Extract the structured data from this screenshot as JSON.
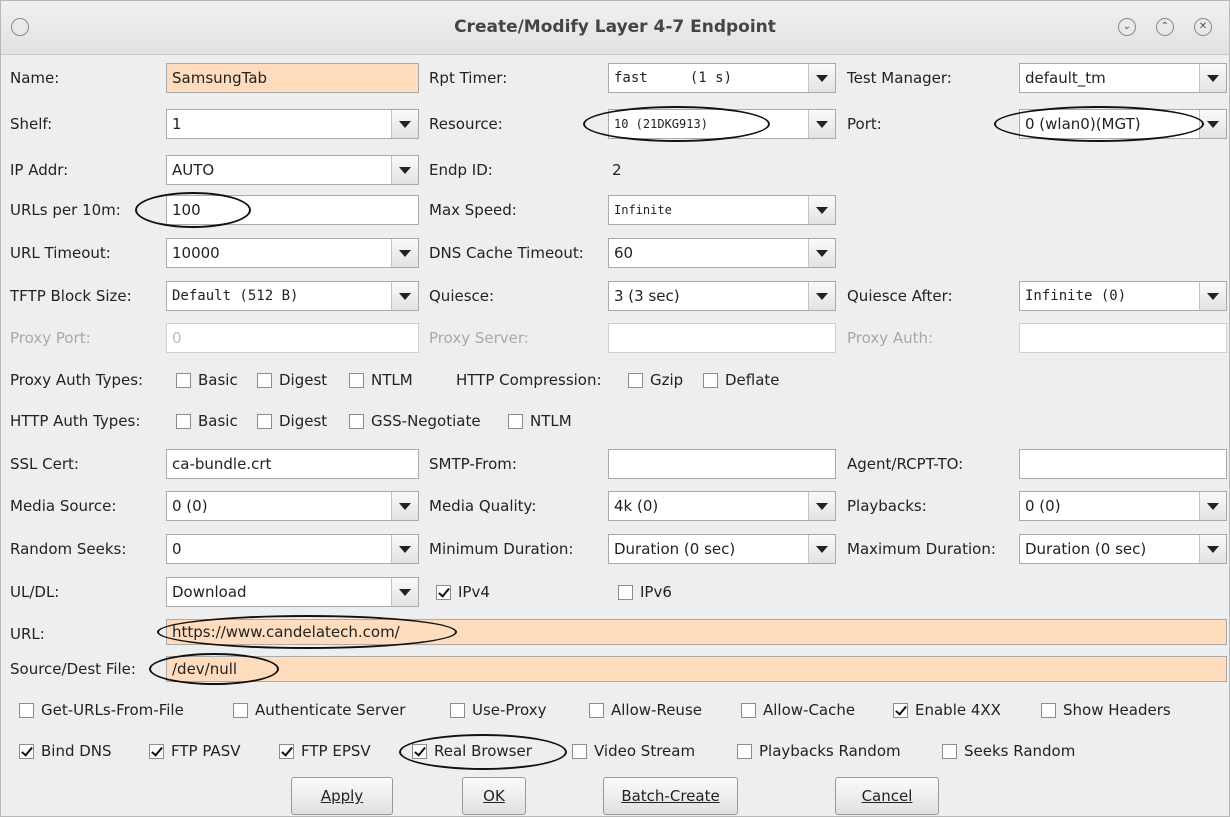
{
  "window": {
    "title": "Create/Modify Layer 4-7 Endpoint"
  },
  "labels": {
    "name": "Name:",
    "rpt_timer": "Rpt Timer:",
    "test_manager": "Test Manager:",
    "shelf": "Shelf:",
    "resource": "Resource:",
    "port": "Port:",
    "ip_addr": "IP Addr:",
    "endp_id": "Endp ID:",
    "urls_per_10m": "URLs per 10m:",
    "max_speed": "Max Speed:",
    "url_timeout": "URL Timeout:",
    "dns_cache_timeout": "DNS Cache Timeout:",
    "tftp_block_size": "TFTP Block Size:",
    "quiesce": "Quiesce:",
    "quiesce_after": "Quiesce After:",
    "proxy_port": "Proxy Port:",
    "proxy_server": "Proxy Server:",
    "proxy_auth": "Proxy Auth:",
    "proxy_auth_types": "Proxy Auth Types:",
    "http_compression": "HTTP Compression:",
    "http_auth_types": "HTTP Auth Types:",
    "ssl_cert": "SSL Cert:",
    "smtp_from": "SMTP-From:",
    "agent_rcpt_to": "Agent/RCPT-TO:",
    "media_source": "Media Source:",
    "media_quality": "Media Quality:",
    "playbacks": "Playbacks:",
    "random_seeks": "Random Seeks:",
    "minimum_duration": "Minimum Duration:",
    "maximum_duration": "Maximum Duration:",
    "ul_dl": "UL/DL:",
    "url": "URL:",
    "source_dest_file": "Source/Dest File:"
  },
  "values": {
    "name": "SamsungTab",
    "rpt_timer": "fast     (1 s)",
    "test_manager": "default_tm",
    "shelf": "1",
    "resource": "10 (21DKG913)",
    "port": "0 (wlan0)(MGT)",
    "ip_addr": "AUTO",
    "endp_id": "2",
    "urls_per_10m": "100",
    "max_speed": "Infinite",
    "url_timeout": "10000",
    "dns_cache_timeout": "60",
    "tftp_block_size": "Default (512 B)",
    "quiesce": "3 (3 sec)",
    "quiesce_after": "Infinite (0)",
    "proxy_port": "0",
    "proxy_server": "",
    "proxy_auth": "",
    "ssl_cert": "ca-bundle.crt",
    "smtp_from": "",
    "agent_rcpt_to": "",
    "media_source": "0 (0)",
    "media_quality": "4k (0)",
    "playbacks": "0 (0)",
    "random_seeks": "0",
    "minimum_duration": "Duration (0 sec)",
    "maximum_duration": "Duration (0 sec)",
    "ul_dl": "Download",
    "url": "https://www.candelatech.com/",
    "source_dest_file": "/dev/null"
  },
  "checkboxes": {
    "proxy_basic": {
      "label": "Basic",
      "checked": false
    },
    "proxy_digest": {
      "label": "Digest",
      "checked": false
    },
    "proxy_ntlm": {
      "label": "NTLM",
      "checked": false
    },
    "gzip": {
      "label": "Gzip",
      "checked": false
    },
    "deflate": {
      "label": "Deflate",
      "checked": false
    },
    "http_basic": {
      "label": "Basic",
      "checked": false
    },
    "http_digest": {
      "label": "Digest",
      "checked": false
    },
    "gss_negotiate": {
      "label": "GSS-Negotiate",
      "checked": false
    },
    "http_ntlm": {
      "label": "NTLM",
      "checked": false
    },
    "ipv4": {
      "label": "IPv4",
      "checked": true
    },
    "ipv6": {
      "label": "IPv6",
      "checked": false
    },
    "get_urls_from_file": {
      "label": "Get-URLs-From-File",
      "checked": false
    },
    "authenticate_server": {
      "label": "Authenticate Server",
      "checked": false
    },
    "use_proxy": {
      "label": "Use-Proxy",
      "checked": false
    },
    "allow_reuse": {
      "label": "Allow-Reuse",
      "checked": false
    },
    "allow_cache": {
      "label": "Allow-Cache",
      "checked": false
    },
    "enable_4xx": {
      "label": "Enable 4XX",
      "checked": true
    },
    "show_headers": {
      "label": "Show Headers",
      "checked": false
    },
    "bind_dns": {
      "label": "Bind DNS",
      "checked": true
    },
    "ftp_pasv": {
      "label": "FTP PASV",
      "checked": true
    },
    "ftp_epsv": {
      "label": "FTP EPSV",
      "checked": true
    },
    "real_browser": {
      "label": "Real Browser",
      "checked": true
    },
    "video_stream": {
      "label": "Video Stream",
      "checked": false
    },
    "playbacks_random": {
      "label": "Playbacks Random",
      "checked": false
    },
    "seeks_random": {
      "label": "Seeks Random",
      "checked": false
    }
  },
  "buttons": {
    "apply": "Apply",
    "ok": "OK",
    "batch_create": "Batch-Create",
    "cancel": "Cancel"
  },
  "colors": {
    "highlight_field": "#ffdcbe",
    "window_bg": "#eeeeee"
  }
}
